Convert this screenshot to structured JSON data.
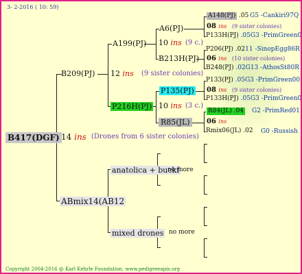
{
  "header": {
    "date_text": "3- 2-2016 ( 10: 59)"
  },
  "root": {
    "id": "B417(DGF)",
    "num": "14",
    "ins": "ins",
    "sisters": "(Drones from 6 sister colonies)"
  },
  "sire_line": {
    "b209": {
      "id": "B209(PJ)",
      "num": "12",
      "ins": "ins",
      "sisters": "(9 sister colonies)"
    },
    "a199": {
      "id": "A199(PJ)",
      "num": "10",
      "ins": "ins",
      "sisters": "(9 c.)"
    },
    "p216": {
      "id": "P216H(PJ)",
      "num": "10",
      "ins": "ins",
      "sisters": "(3 c.)"
    },
    "a6": {
      "id": "A6(PJ)"
    },
    "b213": {
      "id": "B213H(PJ)"
    },
    "p135": {
      "id": "P135(PJ)"
    },
    "r85": {
      "id": "R85(JL)"
    }
  },
  "right_column": {
    "a148": {
      "id": "A148(PJ)",
      "code": ".05",
      "label": "G5 -Cankiri97Q"
    },
    "a148_drones": {
      "num": "08",
      "ins": "ins",
      "sisters": "(9 sister colonies)"
    },
    "p133a": {
      "id": "P133H(PJ)",
      "code": ".05G3 -PrimGreen00"
    },
    "p206": {
      "id": "P206(PJ)",
      "code": ".02",
      "label": "11 -SinopEgg86R"
    },
    "p206_drones": {
      "num": "06",
      "ins": "ins",
      "sisters": "(10 sister colonies)"
    },
    "b248": {
      "id": "B248(PJ)",
      "code": ".02G13 -AthosSt80R"
    },
    "p133b": {
      "id": "P133(PJ)",
      "code": ".05G3 -PrimGreen00"
    },
    "p133b_drones": {
      "num": "08",
      "ins": "ins",
      "sisters": "(9 sister colonies)"
    },
    "p133c": {
      "id": "P133H(PJ)",
      "code": ".05G3 -PrimGreen00"
    },
    "r84": {
      "id": "R84(JL)",
      "code": ".04",
      "label": "G2 -PrimRed01"
    },
    "r84_drones": {
      "num": "06",
      "ins": "ins"
    },
    "rmix": {
      "id": "Rmix06(JL)",
      "code": ".02",
      "label": "G0 -Russish"
    }
  },
  "dam_line": {
    "abmix": {
      "id": "ABmix14(AB12"
    },
    "anatolica": {
      "id": "anatolica + buckf",
      "more": "no more"
    },
    "mixed": {
      "id": "mixed drones",
      "more": "no more"
    }
  },
  "footer": {
    "copyright": "Copyright 2004-2016 @ Karl Kehrle Foundation.   www.pedigreeapis.org"
  },
  "colors": {
    "border": "#e0208a",
    "background": "#ffffd0",
    "root_box": "#c8c8c8",
    "highlight_green": "#22d022",
    "highlight_cyan": "#28e8f0",
    "gray_box": "#b8b8b8",
    "light_box": "#e4e4e4",
    "text_blue": "#0a3aa8",
    "ins_red": "#d01010",
    "purple": "#6a3ab0",
    "footer_green": "#1a7a2a"
  }
}
